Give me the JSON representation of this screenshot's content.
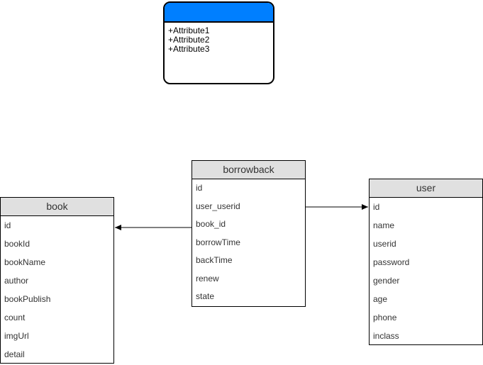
{
  "template_class": {
    "header_color": "#007FFF",
    "attributes": [
      "+Attribute1",
      "+Attribute2",
      "+Attribute3"
    ]
  },
  "entities": {
    "book": {
      "title": "book",
      "fields": [
        "id",
        "bookId",
        "bookName",
        "author",
        "bookPublish",
        "count",
        "imgUrl",
        "detail"
      ]
    },
    "borrowback": {
      "title": "borrowback",
      "fields": [
        "id",
        "user_userid",
        "book_id",
        "borrowTime",
        "backTime",
        "renew",
        "state"
      ]
    },
    "user": {
      "title": "user",
      "fields": [
        "id",
        "name",
        "userid",
        "password",
        "gender",
        "age",
        "phone",
        "inclass"
      ]
    }
  },
  "colors": {
    "header_fill": "#E0E0E0",
    "border": "#000000",
    "text": "#333333"
  },
  "relationships": [
    {
      "from": "borrowback.user_userid",
      "to": "user.id"
    },
    {
      "from": "borrowback.book_id",
      "to": "book.id"
    }
  ]
}
